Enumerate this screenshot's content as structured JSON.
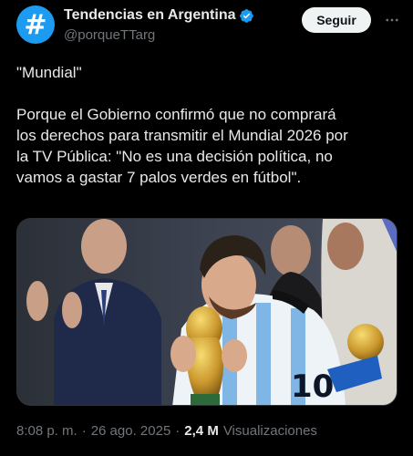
{
  "account": {
    "display_name": "Tendencias en Argentina",
    "handle": "@porqueTTarg",
    "avatar_glyph": "#",
    "avatar_color": "#1d9bf0",
    "verified": true
  },
  "actions": {
    "follow_label": "Seguir",
    "more_icon": "more-icon"
  },
  "tweet": {
    "title": "\"Mundial\"",
    "lines": [
      "Porque el Gobierno confirmó que no comprará",
      "los derechos para transmitir el Mundial 2026 por",
      "la TV Pública: \"No es una decisión política, no",
      "vamos a gastar 7 palos verdes en fútbol\"."
    ]
  },
  "media": {
    "alt": "photo",
    "jersey_number": "10"
  },
  "meta": {
    "time": "8:08 p. m.",
    "separator": "·",
    "date": "26 ago. 2025",
    "separator2": "·",
    "views_count": "2,4 M",
    "views_label": "Visualizaciones"
  },
  "colors": {
    "background": "#000000",
    "text": "#e7e9ea",
    "secondary": "#71767b",
    "accent": "#1d9bf0"
  }
}
